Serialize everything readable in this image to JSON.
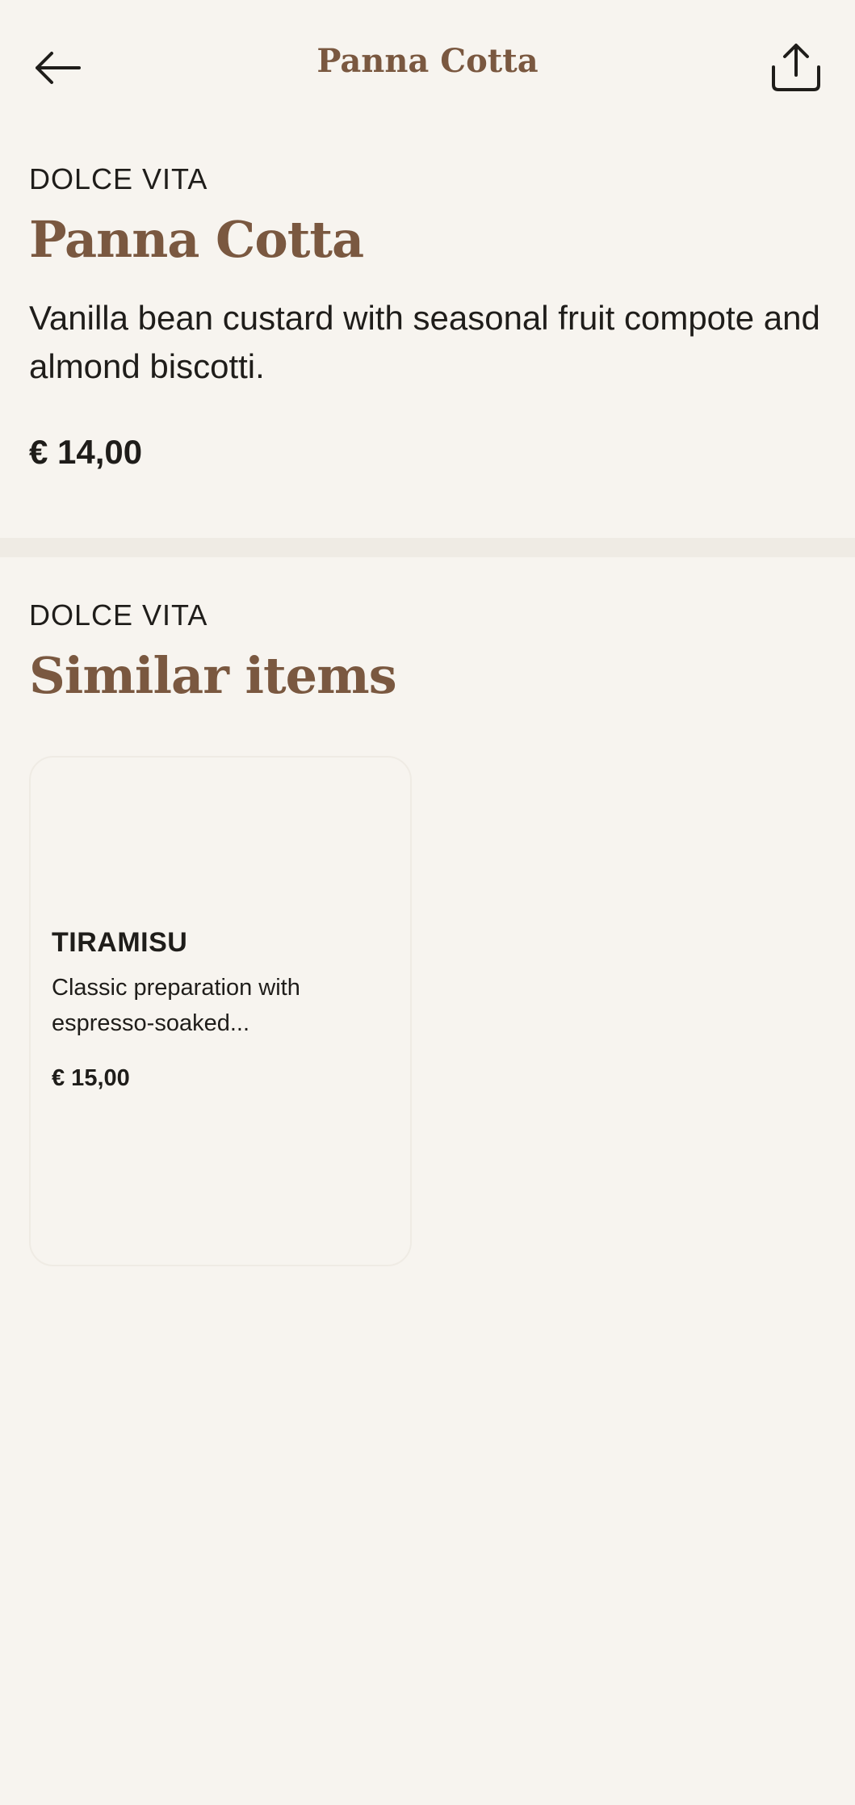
{
  "header": {
    "title": "Panna Cotta",
    "back_icon": "arrow-left-icon",
    "share_icon": "share-upload-icon"
  },
  "item": {
    "category": "DOLCE VITA",
    "name": "Panna Cotta",
    "description": "Vanilla bean custard with seasonal fruit compote and almond biscotti.",
    "price": "€ 14,00"
  },
  "similar": {
    "category": "DOLCE VITA",
    "heading": "Similar items",
    "items": [
      {
        "name": "TIRAMISU",
        "description_line1": "Classic preparation with",
        "description_line2": "espresso-soaked...",
        "price": "€ 15,00"
      }
    ]
  },
  "colors": {
    "background": "#f7f4ef",
    "accent_brown": "#7a5840",
    "text": "#1f1d1a",
    "divider": "#efebe4"
  }
}
